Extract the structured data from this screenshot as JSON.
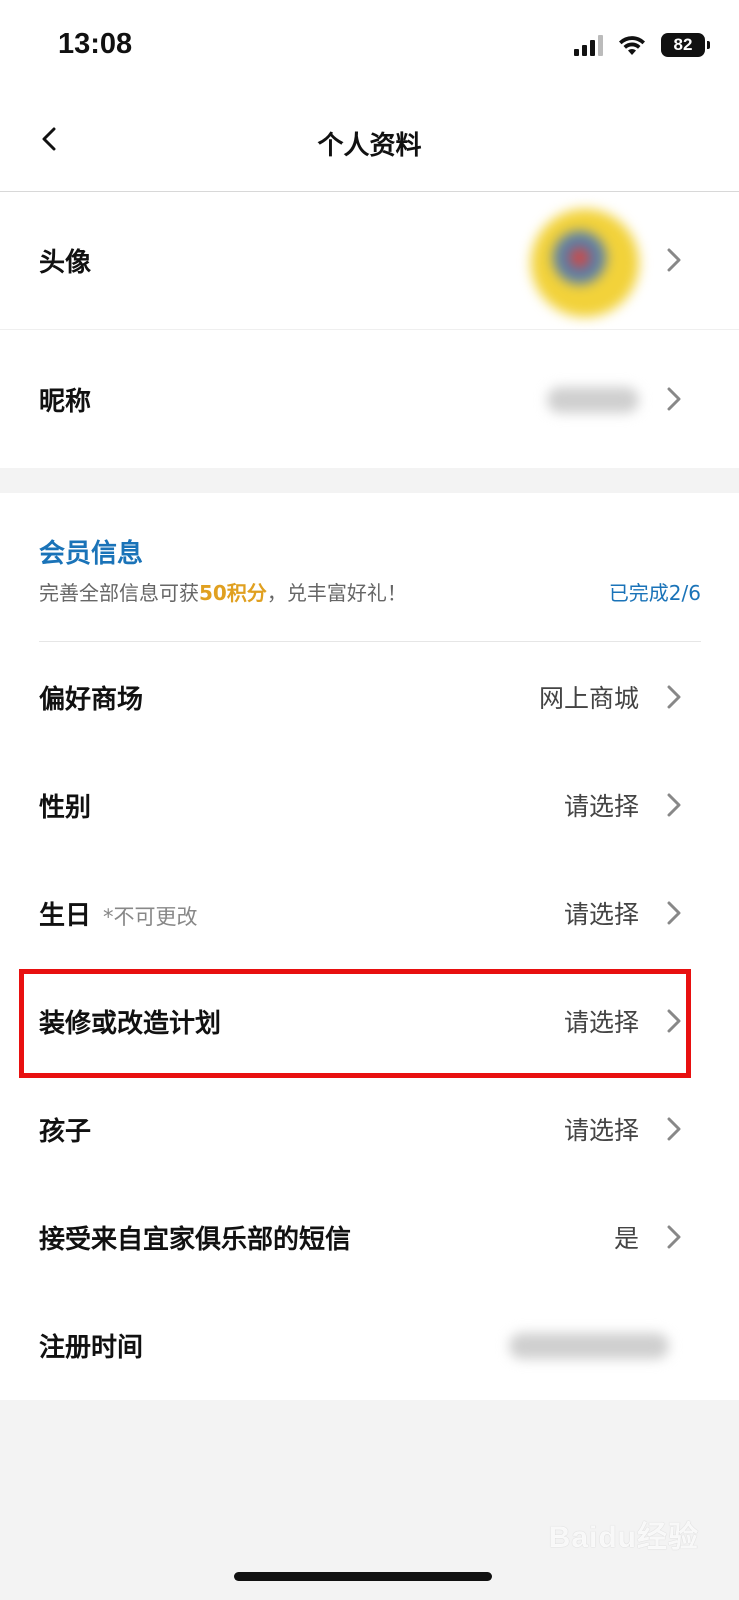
{
  "status_bar": {
    "time": "13:08",
    "battery": "82"
  },
  "nav": {
    "title": "个人资料"
  },
  "profile": {
    "avatar_label": "头像",
    "nickname_label": "昵称"
  },
  "member": {
    "title": "会员信息",
    "subtitle_before": "完善全部信息可获",
    "subtitle_points": "50积分",
    "subtitle_after": "，兑丰富好礼！",
    "progress": "已完成2/6",
    "rows": [
      {
        "label": "偏好商场",
        "value": "网上商城"
      },
      {
        "label": "性别",
        "value": "请选择"
      },
      {
        "label": "生日",
        "note": "*不可更改",
        "value": "请选择"
      },
      {
        "label": "装修或改造计划",
        "value": "请选择"
      },
      {
        "label": "孩子",
        "value": "请选择"
      },
      {
        "label": "接受来自宜家俱乐部的短信",
        "value": "是"
      },
      {
        "label": "注册时间"
      }
    ]
  },
  "watermark": "Baidu经验",
  "colors": {
    "accent": "#1a73b8",
    "points": "#e0a020",
    "highlight": "#e81010"
  }
}
